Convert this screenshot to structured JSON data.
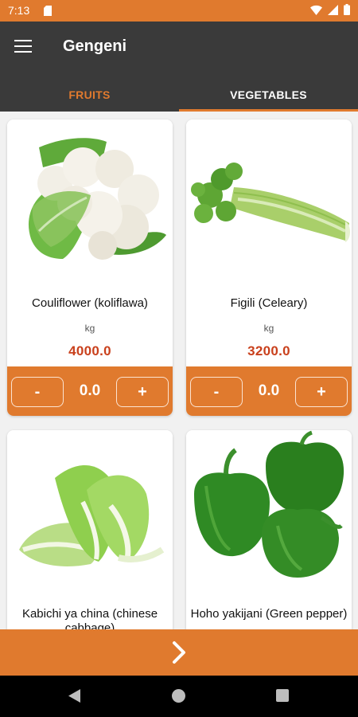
{
  "status": {
    "time": "7:13",
    "icons": [
      "sd-card-icon",
      "wifi-icon",
      "signal-icon",
      "battery-icon"
    ]
  },
  "app": {
    "title": "Gengeni"
  },
  "tabs": [
    {
      "label": "FRUITS"
    },
    {
      "label": "VEGETABLES"
    }
  ],
  "products": [
    {
      "name": "Couliflower (koliflawa)",
      "unit": "kg",
      "price": "4000.0",
      "quantity": "0.0",
      "minus": "-",
      "plus": "+",
      "image": "cauliflower"
    },
    {
      "name": "Figili (Celeary)",
      "unit": "kg",
      "price": "3200.0",
      "quantity": "0.0",
      "minus": "-",
      "plus": "+",
      "image": "celery"
    },
    {
      "name": "Kabichi ya china (chinese cabbage)",
      "image": "chinese-cabbage"
    },
    {
      "name": "Hoho yakijani (Green pepper)",
      "image": "green-pepper"
    }
  ],
  "colors": {
    "accent": "#e07a2e",
    "appbar": "#3a3a3a",
    "price": "#c9401c"
  }
}
